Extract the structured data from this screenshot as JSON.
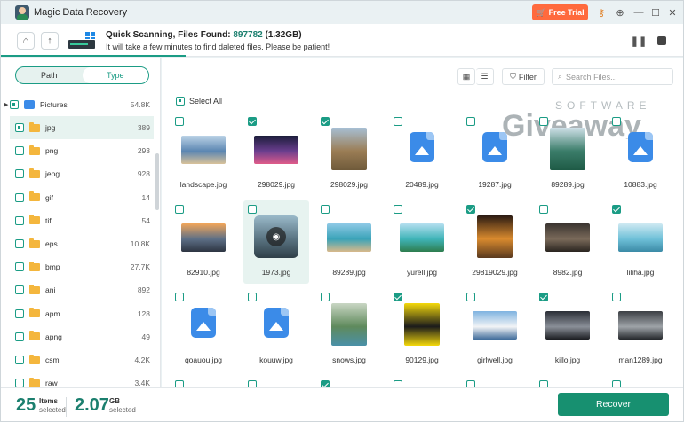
{
  "app": {
    "title": "Magic Data Recovery",
    "free_trial": "Free Trial"
  },
  "scan": {
    "title_prefix": "Quick Scanning, Files Found: ",
    "count": "897782",
    "size": " (1.32GB)",
    "subtitle": "It will take a few minutes to find daleted files. Please be patient!",
    "progress": 0.27
  },
  "sidebar": {
    "tabs": [
      "Path",
      "Type"
    ],
    "active_tab": "Type",
    "root": {
      "label": "Pictures",
      "count": "54.8K"
    },
    "items": [
      {
        "label": "jpg",
        "count": "389",
        "selected": true
      },
      {
        "label": "png",
        "count": "293"
      },
      {
        "label": "jepg",
        "count": "928"
      },
      {
        "label": "gif",
        "count": "14"
      },
      {
        "label": "tif",
        "count": "54"
      },
      {
        "label": "eps",
        "count": "10.8K"
      },
      {
        "label": "bmp",
        "count": "27.7K"
      },
      {
        "label": "ani",
        "count": "892"
      },
      {
        "label": "apm",
        "count": "128"
      },
      {
        "label": "apng",
        "count": "49"
      },
      {
        "label": "csm",
        "count": "4.2K"
      },
      {
        "label": "raw",
        "count": "3.4K"
      }
    ]
  },
  "toolbar": {
    "filter": "Filter",
    "search_placeholder": "Search Files..."
  },
  "select_all": "Select All",
  "watermark": {
    "line1": "SOFTWARE",
    "line2": "Giveaway"
  },
  "files": [
    {
      "name": "landscape.jpg",
      "checked": false,
      "kind": "photo",
      "colors": [
        "#bcd3e6",
        "#5b86b2",
        "#d9c29a"
      ]
    },
    {
      "name": "298029.jpg",
      "checked": true,
      "kind": "photo",
      "colors": [
        "#1b1d3a",
        "#6a3e8e",
        "#e05c8a"
      ]
    },
    {
      "name": "298029.jpg",
      "checked": true,
      "kind": "photo-tall",
      "colors": [
        "#a7bfd4",
        "#9b7d55",
        "#6f5a3a"
      ]
    },
    {
      "name": "20489.jpg",
      "checked": false,
      "kind": "generic"
    },
    {
      "name": "19287.jpg",
      "checked": false,
      "kind": "generic"
    },
    {
      "name": "89289.jpg",
      "checked": false,
      "kind": "photo-tall",
      "colors": [
        "#cfe0e8",
        "#3b7d6a",
        "#1e5a45"
      ]
    },
    {
      "name": "10883.jpg",
      "checked": false,
      "kind": "generic"
    },
    {
      "name": "82910.jpg",
      "checked": false,
      "kind": "photo",
      "colors": [
        "#f2a65a",
        "#5d6f86",
        "#2d3542"
      ]
    },
    {
      "name": "1973.jpg",
      "checked": false,
      "kind": "photo-eye",
      "colors": [
        "#9ab9c9",
        "#5a7482",
        "#2f3f48"
      ],
      "highlight": true
    },
    {
      "name": "89289.jpg",
      "checked": false,
      "kind": "photo",
      "colors": [
        "#8fc9e6",
        "#3aa3b8",
        "#d9b98a"
      ]
    },
    {
      "name": "yurell.jpg",
      "checked": false,
      "kind": "photo",
      "colors": [
        "#b5dff0",
        "#3fb4b8",
        "#2e7d4e"
      ]
    },
    {
      "name": "29819029.jpg",
      "checked": true,
      "kind": "photo-tall",
      "colors": [
        "#2a1a12",
        "#d98a2e",
        "#5a3a1f"
      ]
    },
    {
      "name": "8982.jpg",
      "checked": false,
      "kind": "photo",
      "colors": [
        "#3a3430",
        "#7a6a5a",
        "#2a2520"
      ]
    },
    {
      "name": "liliha.jpg",
      "checked": true,
      "kind": "photo",
      "colors": [
        "#cfe9f2",
        "#6ec0d8",
        "#3b8aa6"
      ]
    },
    {
      "name": "qoauou.jpg",
      "checked": false,
      "kind": "generic"
    },
    {
      "name": "kouuw.jpg",
      "checked": false,
      "kind": "generic"
    },
    {
      "name": "snows.jpg",
      "checked": false,
      "kind": "photo-tall",
      "colors": [
        "#c9d6c4",
        "#5f8a5c",
        "#4a90a8"
      ]
    },
    {
      "name": "90129.jpg",
      "checked": true,
      "kind": "photo-tall",
      "colors": [
        "#f5d90a",
        "#1b1b1b",
        "#f5d90a"
      ]
    },
    {
      "name": "girlwell.jpg",
      "checked": false,
      "kind": "photo",
      "colors": [
        "#7fb3e0",
        "#f2f4f6",
        "#3e6b9a"
      ]
    },
    {
      "name": "killo.jpg",
      "checked": true,
      "kind": "photo",
      "colors": [
        "#2a2e36",
        "#8a8f98",
        "#1a1c20"
      ]
    },
    {
      "name": "man1289.jpg",
      "checked": false,
      "kind": "photo",
      "colors": [
        "#3c3f44",
        "#9ea3a8",
        "#24272b"
      ]
    }
  ],
  "partial_row_checks": [
    false,
    false,
    true,
    false,
    false,
    false,
    false
  ],
  "footer": {
    "items_count": "25",
    "items_label": "Items",
    "items_sub": "selected",
    "size": "2.07",
    "size_unit": "GB",
    "size_sub": "selected",
    "recover": "Recover"
  }
}
